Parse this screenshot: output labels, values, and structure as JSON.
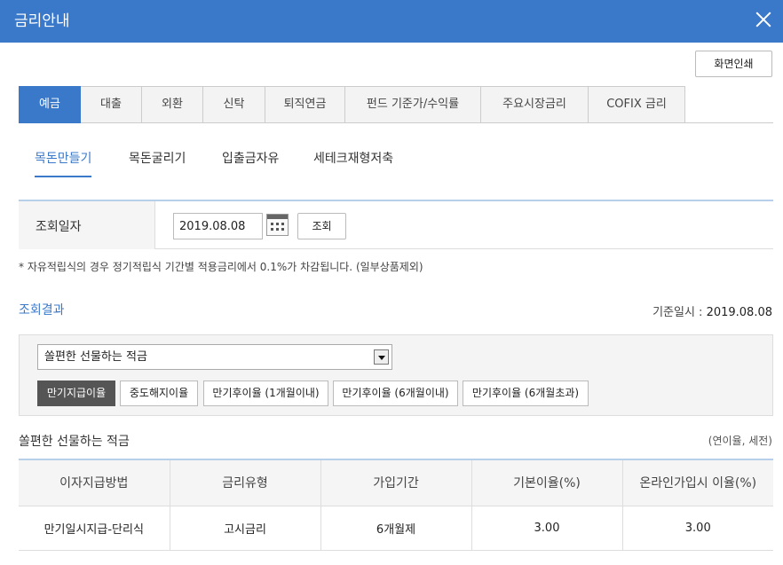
{
  "window": {
    "title": "금리안내"
  },
  "toolbar": {
    "print_label": "화면인쇄"
  },
  "tabs": [
    "예금",
    "대출",
    "외환",
    "신탁",
    "퇴직연금",
    "펀드 기준가/수익률",
    "주요시장금리",
    "COFIX 금리"
  ],
  "subtabs": [
    "목돈만들기",
    "목돈굴리기",
    "입출금자유",
    "세테크재형저축"
  ],
  "search": {
    "label": "조회일자",
    "date": "2019.08.08",
    "button": "조회"
  },
  "note": "* 자유적립식의 경우 정기적립식 기간별 적용금리에서 0.1%가 차감됩니다. (일부상품제외)",
  "result": {
    "title": "조회결과",
    "base_date_label": "기준일시 :",
    "base_date": "2019.08.08",
    "selected_product": "쏠편한 선물하는 적금",
    "chips": [
      "만기지급이율",
      "중도해지이율",
      "만기후이율 (1개월이내)",
      "만기후이율 (6개월이내)",
      "만기후이율 (6개월초과)"
    ]
  },
  "table": {
    "product_name": "쏠편한 선물하는 적금",
    "unit_note": "(연이율, 세전)",
    "headers": [
      "이자지급방법",
      "금리유형",
      "가입기간",
      "기본이율(%)",
      "온라인가입시 이율(%)"
    ],
    "rows": [
      [
        "만기일시지급-단리식",
        "고시금리",
        "6개월제",
        "3.00",
        "3.00"
      ]
    ]
  },
  "colors": {
    "accent": "#3a78c9",
    "chip_active": "#555555"
  }
}
